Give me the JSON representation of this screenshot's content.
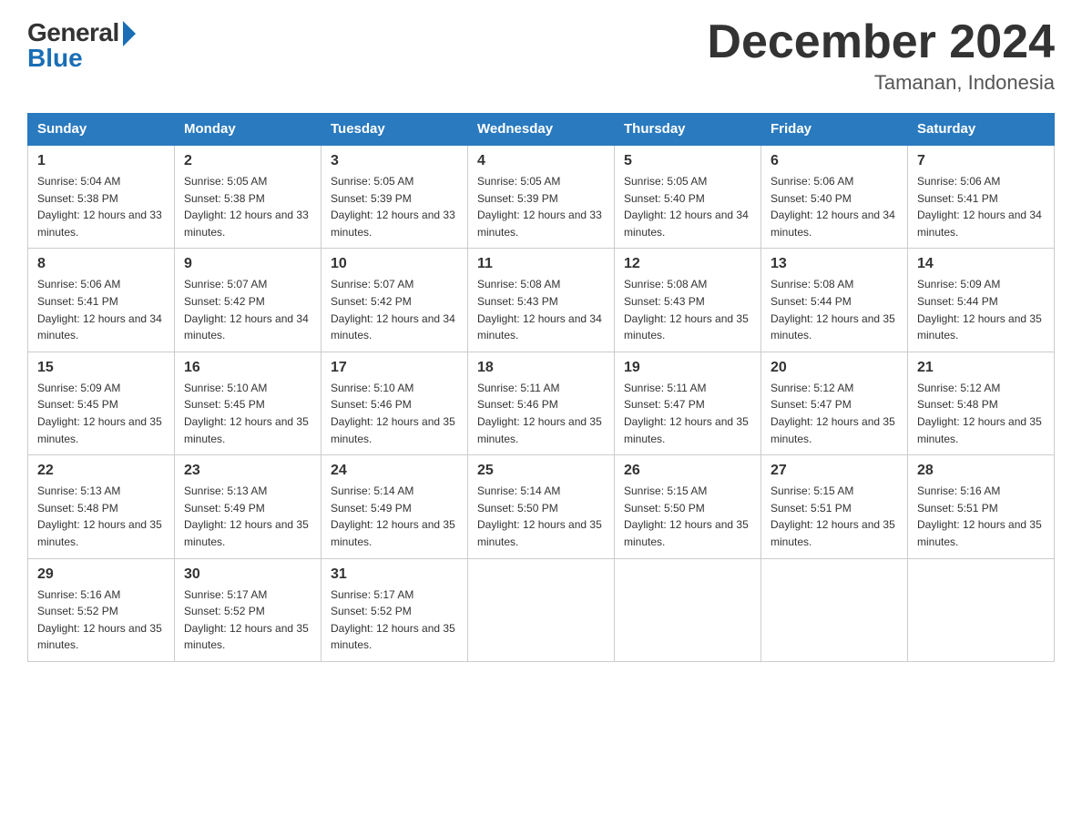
{
  "header": {
    "logo_general": "General",
    "logo_blue": "Blue",
    "month_title": "December 2024",
    "location": "Tamanan, Indonesia"
  },
  "days_of_week": [
    "Sunday",
    "Monday",
    "Tuesday",
    "Wednesday",
    "Thursday",
    "Friday",
    "Saturday"
  ],
  "weeks": [
    [
      {
        "day": "1",
        "sunrise": "5:04 AM",
        "sunset": "5:38 PM",
        "daylight": "12 hours and 33 minutes."
      },
      {
        "day": "2",
        "sunrise": "5:05 AM",
        "sunset": "5:38 PM",
        "daylight": "12 hours and 33 minutes."
      },
      {
        "day": "3",
        "sunrise": "5:05 AM",
        "sunset": "5:39 PM",
        "daylight": "12 hours and 33 minutes."
      },
      {
        "day": "4",
        "sunrise": "5:05 AM",
        "sunset": "5:39 PM",
        "daylight": "12 hours and 33 minutes."
      },
      {
        "day": "5",
        "sunrise": "5:05 AM",
        "sunset": "5:40 PM",
        "daylight": "12 hours and 34 minutes."
      },
      {
        "day": "6",
        "sunrise": "5:06 AM",
        "sunset": "5:40 PM",
        "daylight": "12 hours and 34 minutes."
      },
      {
        "day": "7",
        "sunrise": "5:06 AM",
        "sunset": "5:41 PM",
        "daylight": "12 hours and 34 minutes."
      }
    ],
    [
      {
        "day": "8",
        "sunrise": "5:06 AM",
        "sunset": "5:41 PM",
        "daylight": "12 hours and 34 minutes."
      },
      {
        "day": "9",
        "sunrise": "5:07 AM",
        "sunset": "5:42 PM",
        "daylight": "12 hours and 34 minutes."
      },
      {
        "day": "10",
        "sunrise": "5:07 AM",
        "sunset": "5:42 PM",
        "daylight": "12 hours and 34 minutes."
      },
      {
        "day": "11",
        "sunrise": "5:08 AM",
        "sunset": "5:43 PM",
        "daylight": "12 hours and 34 minutes."
      },
      {
        "day": "12",
        "sunrise": "5:08 AM",
        "sunset": "5:43 PM",
        "daylight": "12 hours and 35 minutes."
      },
      {
        "day": "13",
        "sunrise": "5:08 AM",
        "sunset": "5:44 PM",
        "daylight": "12 hours and 35 minutes."
      },
      {
        "day": "14",
        "sunrise": "5:09 AM",
        "sunset": "5:44 PM",
        "daylight": "12 hours and 35 minutes."
      }
    ],
    [
      {
        "day": "15",
        "sunrise": "5:09 AM",
        "sunset": "5:45 PM",
        "daylight": "12 hours and 35 minutes."
      },
      {
        "day": "16",
        "sunrise": "5:10 AM",
        "sunset": "5:45 PM",
        "daylight": "12 hours and 35 minutes."
      },
      {
        "day": "17",
        "sunrise": "5:10 AM",
        "sunset": "5:46 PM",
        "daylight": "12 hours and 35 minutes."
      },
      {
        "day": "18",
        "sunrise": "5:11 AM",
        "sunset": "5:46 PM",
        "daylight": "12 hours and 35 minutes."
      },
      {
        "day": "19",
        "sunrise": "5:11 AM",
        "sunset": "5:47 PM",
        "daylight": "12 hours and 35 minutes."
      },
      {
        "day": "20",
        "sunrise": "5:12 AM",
        "sunset": "5:47 PM",
        "daylight": "12 hours and 35 minutes."
      },
      {
        "day": "21",
        "sunrise": "5:12 AM",
        "sunset": "5:48 PM",
        "daylight": "12 hours and 35 minutes."
      }
    ],
    [
      {
        "day": "22",
        "sunrise": "5:13 AM",
        "sunset": "5:48 PM",
        "daylight": "12 hours and 35 minutes."
      },
      {
        "day": "23",
        "sunrise": "5:13 AM",
        "sunset": "5:49 PM",
        "daylight": "12 hours and 35 minutes."
      },
      {
        "day": "24",
        "sunrise": "5:14 AM",
        "sunset": "5:49 PM",
        "daylight": "12 hours and 35 minutes."
      },
      {
        "day": "25",
        "sunrise": "5:14 AM",
        "sunset": "5:50 PM",
        "daylight": "12 hours and 35 minutes."
      },
      {
        "day": "26",
        "sunrise": "5:15 AM",
        "sunset": "5:50 PM",
        "daylight": "12 hours and 35 minutes."
      },
      {
        "day": "27",
        "sunrise": "5:15 AM",
        "sunset": "5:51 PM",
        "daylight": "12 hours and 35 minutes."
      },
      {
        "day": "28",
        "sunrise": "5:16 AM",
        "sunset": "5:51 PM",
        "daylight": "12 hours and 35 minutes."
      }
    ],
    [
      {
        "day": "29",
        "sunrise": "5:16 AM",
        "sunset": "5:52 PM",
        "daylight": "12 hours and 35 minutes."
      },
      {
        "day": "30",
        "sunrise": "5:17 AM",
        "sunset": "5:52 PM",
        "daylight": "12 hours and 35 minutes."
      },
      {
        "day": "31",
        "sunrise": "5:17 AM",
        "sunset": "5:52 PM",
        "daylight": "12 hours and 35 minutes."
      },
      null,
      null,
      null,
      null
    ]
  ],
  "labels": {
    "sunrise": "Sunrise:",
    "sunset": "Sunset:",
    "daylight": "Daylight:"
  }
}
